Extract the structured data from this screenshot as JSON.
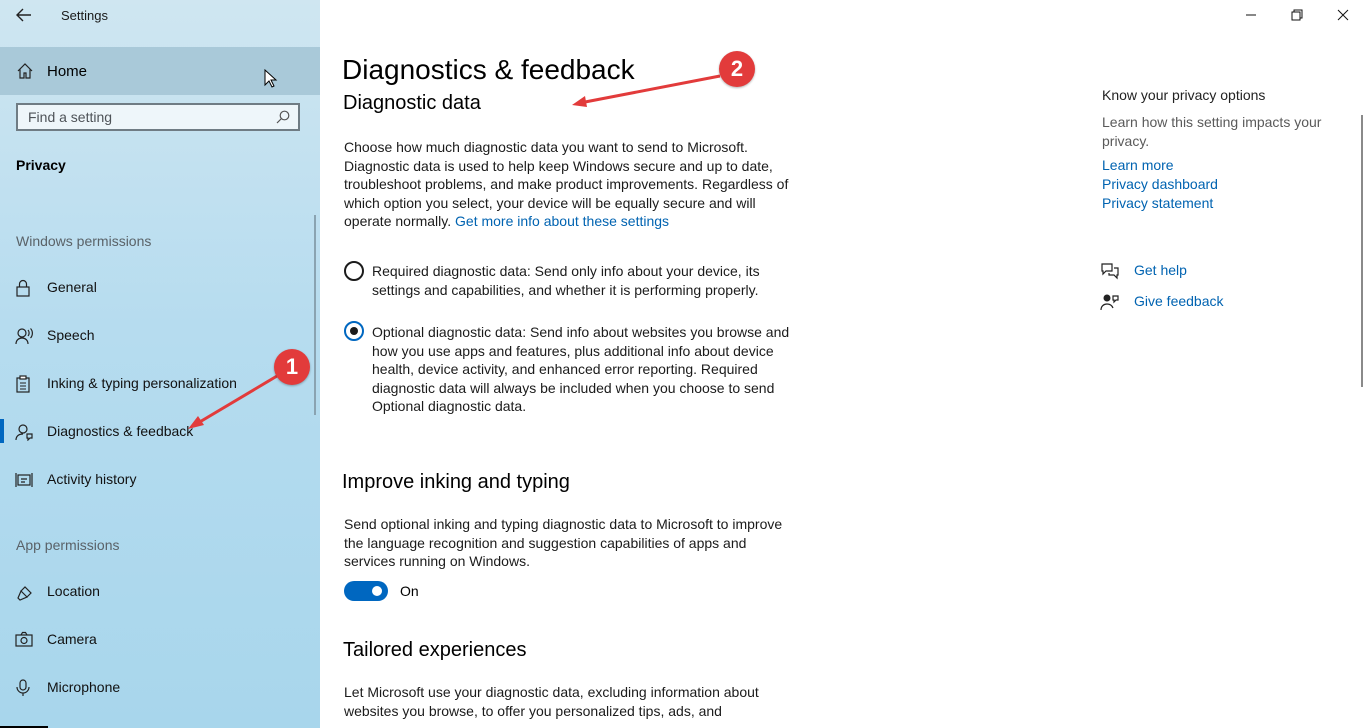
{
  "window": {
    "title": "Settings",
    "controls": {
      "minimize": "minimize-icon",
      "restore": "restore-icon",
      "close": "close-icon"
    }
  },
  "sidebar": {
    "home_label": "Home",
    "search_placeholder": "Find a setting",
    "category": "Privacy",
    "section_windows": "Windows permissions",
    "windows_items": [
      {
        "label": "General",
        "icon": "lock-icon"
      },
      {
        "label": "Speech",
        "icon": "speech-icon"
      },
      {
        "label": "Inking & typing personalization",
        "icon": "clipboard-icon"
      },
      {
        "label": "Diagnostics & feedback",
        "icon": "diagnostics-icon",
        "active": true
      },
      {
        "label": "Activity history",
        "icon": "activity-history-icon"
      }
    ],
    "section_app": "App permissions",
    "app_items": [
      {
        "label": "Location",
        "icon": "location-icon"
      },
      {
        "label": "Camera",
        "icon": "camera-icon"
      },
      {
        "label": "Microphone",
        "icon": "microphone-icon"
      }
    ]
  },
  "main": {
    "page_title": "Diagnostics & feedback",
    "diagnostic_heading": "Diagnostic data",
    "diagnostic_intro": "Choose how much diagnostic data you want to send to Microsoft. Diagnostic data is used to help keep Windows secure and up to date, troubleshoot problems, and make product improvements. Regardless of which option you select, your device will be equally secure and will operate normally.",
    "diagnostic_link": "Get more info about these settings",
    "options": [
      {
        "label": "Required diagnostic data: Send only info about your device, its settings and capabilities, and whether it is performing properly.",
        "checked": false
      },
      {
        "label": "Optional diagnostic data: Send info about websites you browse and how you use apps and features, plus additional info about device health, device activity, and enhanced error reporting. Required diagnostic data will always be included when you choose to send Optional diagnostic data.",
        "checked": true
      }
    ],
    "inking_heading": "Improve inking and typing",
    "inking_text": "Send optional inking and typing diagnostic data to Microsoft to improve the language recognition and suggestion capabilities of apps and services running on Windows.",
    "inking_toggle_label": "On",
    "tailored_heading": "Tailored experiences",
    "tailored_text": "Let Microsoft use your diagnostic data, excluding information about websites you browse, to offer you personalized tips, ads, and"
  },
  "right": {
    "heading": "Know your privacy options",
    "description": "Learn how this setting impacts your privacy.",
    "links": [
      "Learn more",
      "Privacy dashboard",
      "Privacy statement"
    ],
    "get_help": "Get help",
    "give_feedback": "Give feedback"
  },
  "annotations": [
    "1",
    "2"
  ],
  "colors": {
    "accent": "#0067c0",
    "link": "#0063b1",
    "annotation": "#e23b3b"
  }
}
